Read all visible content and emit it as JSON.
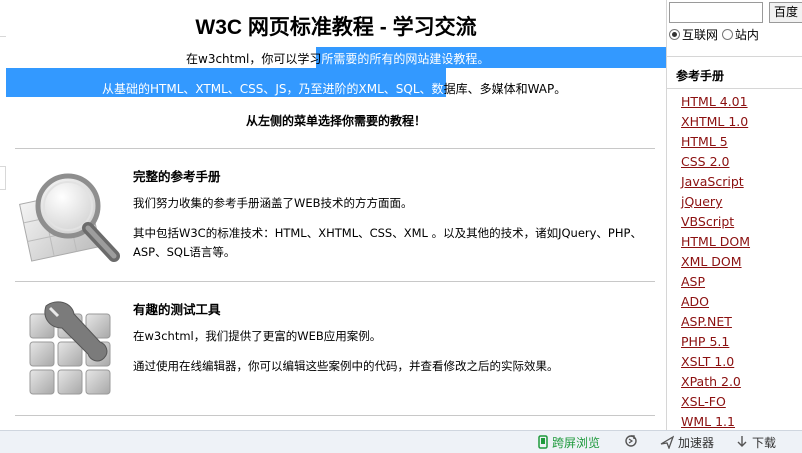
{
  "title": "W3C 网页标准教程 - 学习交流",
  "intro": {
    "line1_plain": "在w3chtml，你可以学习",
    "line1_selected": "所需要的所有的网站建设教程。",
    "line2_selected": "从基础的HTML、XTML、CSS、JS，乃至进阶的XML、SQL、数",
    "line2_plain": "据库、多媒体和WAP。",
    "line3": "从左侧的菜单选择你需要的教程！"
  },
  "features": [
    {
      "title": "完整的参考手册",
      "text1": "我们努力收集的参考手册涵盖了WEB技术的方方面面。",
      "text2": "其中包括W3C的标准技术：HTML、XHTML、CSS、XML 。以及其他的技术，诸如JQuery、PHP、ASP、SQL语言等。"
    },
    {
      "title": "有趣的测试工具",
      "text1": "在w3chtml，我们提供了更富的WEB应用案例。",
      "text2": "通过使用在线编辑器，你可以编辑这些案例中的代码，并查看修改之后的实际效果。"
    }
  ],
  "search": {
    "value": "",
    "button": "百度",
    "options": [
      "互联网",
      "站内"
    ],
    "selected": "互联网"
  },
  "sidebar": {
    "heading": "参考手册",
    "links": [
      "HTML 4.01",
      "XHTML 1.0",
      "HTML 5",
      "CSS 2.0",
      "JavaScript",
      "jQuery",
      "VBScript",
      "HTML DOM",
      "XML DOM",
      "ASP",
      "ADO",
      "ASP.NET",
      "PHP 5.1",
      "XSLT 1.0",
      "XPath 2.0",
      "XSL-FO",
      "WML 1.1"
    ]
  },
  "statusbar": {
    "items": [
      "跨屏浏览",
      "加速器",
      "下载"
    ]
  },
  "colors": {
    "selection": "#3399ff",
    "link": "#8b1010",
    "statusbar_bg": "#eef2f7",
    "accent_green": "#1e9a3c"
  },
  "icons": [
    "magnifier-icon",
    "wrench-icon",
    "phone-icon",
    "refresh-icon",
    "plane-icon",
    "download-icon"
  ]
}
